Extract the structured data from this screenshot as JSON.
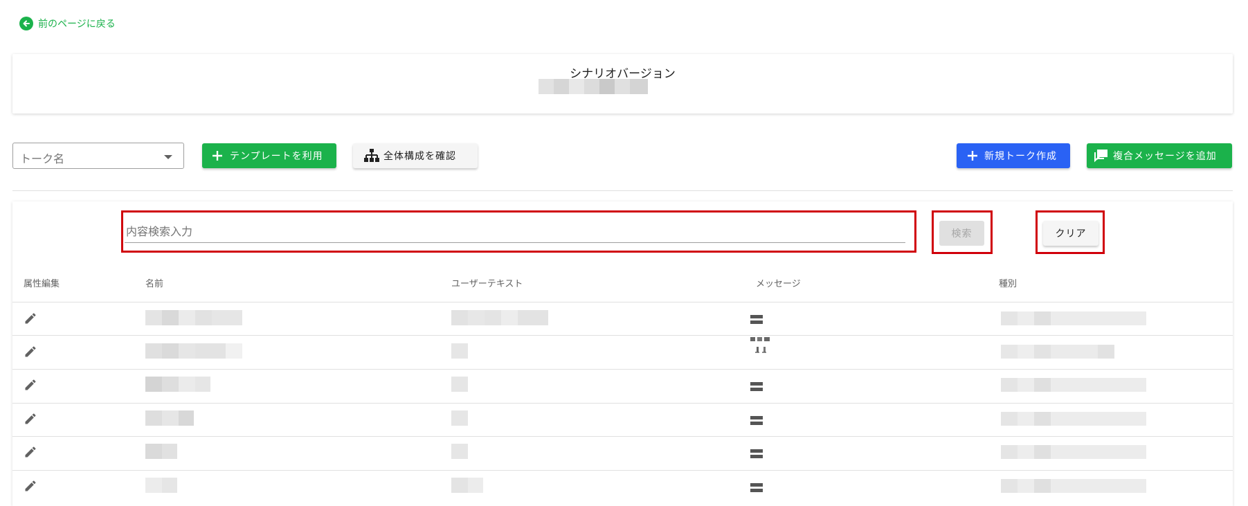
{
  "nav": {
    "back_label": "前のページに戻る"
  },
  "header": {
    "title": "シナリオバージョン"
  },
  "toolbar": {
    "talk_select_placeholder": "トーク名",
    "template_button": "テンプレートを利用",
    "structure_button": "全体構成を確認",
    "new_talk_button": "新規トーク作成",
    "add_composite_button": "複合メッセージを追加"
  },
  "search": {
    "placeholder": "内容検索入力",
    "value": "",
    "search_button": "検索",
    "clear_button": "クリア"
  },
  "table": {
    "columns": [
      "属性編集",
      "名前",
      "ユーザーテキスト",
      "メッセージ",
      "種別"
    ],
    "rows": [
      {
        "message_icon": "list-icon"
      },
      {
        "message_icon": "multi-message-icon"
      },
      {
        "message_icon": "list-icon"
      },
      {
        "message_icon": "list-icon"
      },
      {
        "message_icon": "list-icon"
      },
      {
        "message_icon": "list-icon"
      }
    ]
  },
  "colors": {
    "accent_green": "#1bb24b",
    "accent_blue": "#2a62f4",
    "highlight_red": "#d0000a"
  }
}
